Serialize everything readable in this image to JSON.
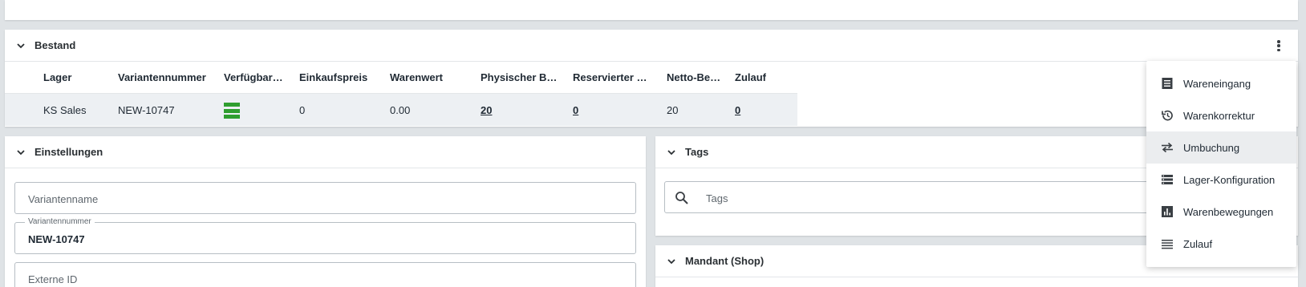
{
  "bestand": {
    "title": "Bestand",
    "columns": [
      "Lager",
      "Variantennummer",
      "Verfügbar…",
      "Einkaufspreis",
      "Warenwert",
      "Physischer B…",
      "Reservierter …",
      "Netto-Be…",
      "Zulauf"
    ],
    "row": {
      "lager": "KS Sales",
      "variantennummer": "NEW-10747",
      "verfuegbar_status": "available",
      "einkaufspreis": "0",
      "warenwert": "0.00",
      "physischer_bestand": "20",
      "reservierter_bestand": "0",
      "netto_bestand": "20",
      "zulauf": "0"
    },
    "available_color": "#2f9e2f"
  },
  "einstellungen": {
    "title": "Einstellungen",
    "variantenname_placeholder": "Variantenname",
    "variantennummer_label": "Variantennummer",
    "variantennummer_value": "NEW-10747",
    "externe_id_placeholder": "Externe ID"
  },
  "tags": {
    "title": "Tags",
    "placeholder": "Tags"
  },
  "mandant": {
    "title": "Mandant (Shop)"
  },
  "menu": {
    "items": [
      {
        "label": "Wareneingang",
        "icon": "receipt-icon"
      },
      {
        "label": "Warenkorrektur",
        "icon": "history-icon"
      },
      {
        "label": "Umbuchung",
        "icon": "swap-arrows-icon",
        "active": true
      },
      {
        "label": "Lager-Konfiguration",
        "icon": "list-config-icon"
      },
      {
        "label": "Warenbewegungen",
        "icon": "bar-chart-icon"
      },
      {
        "label": "Zulauf",
        "icon": "lines-icon"
      }
    ]
  }
}
